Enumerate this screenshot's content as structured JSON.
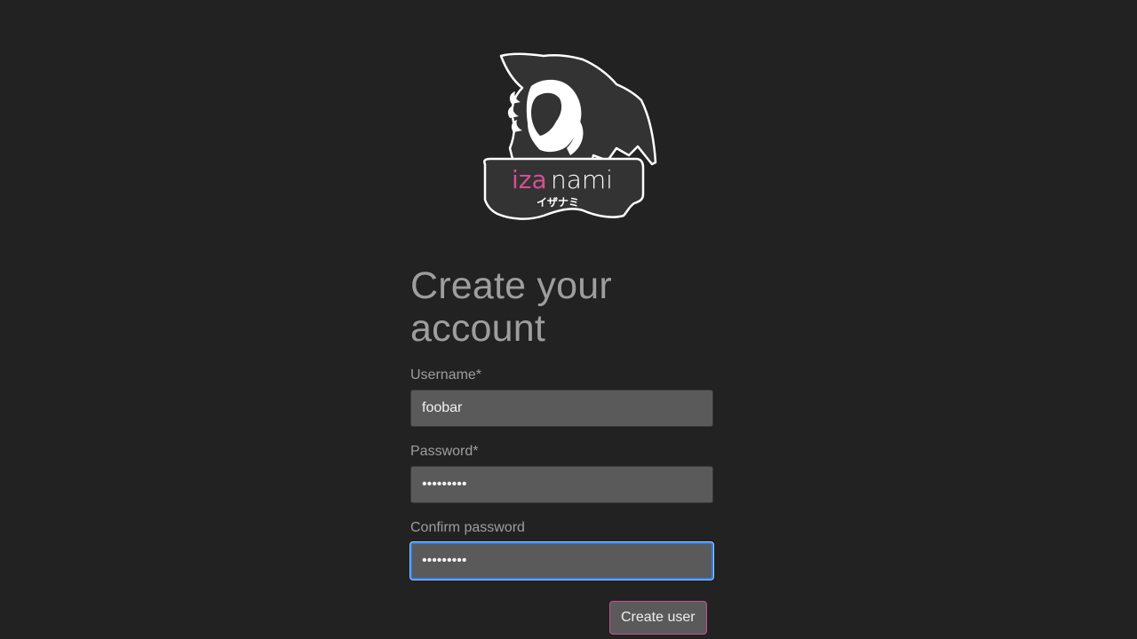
{
  "logo": {
    "brand_pink": "iza",
    "brand_white": "nami",
    "katakana": "イザナミ",
    "accent_color": "#d44f93"
  },
  "form": {
    "title_line1": "Create your",
    "title_line2": "account",
    "username_label": "Username*",
    "username_value": "foobar",
    "password_label": "Password*",
    "password_value": "•••••••••",
    "confirm_label": "Confirm password",
    "confirm_value": "•••••••••",
    "submit_label": "Create user"
  }
}
